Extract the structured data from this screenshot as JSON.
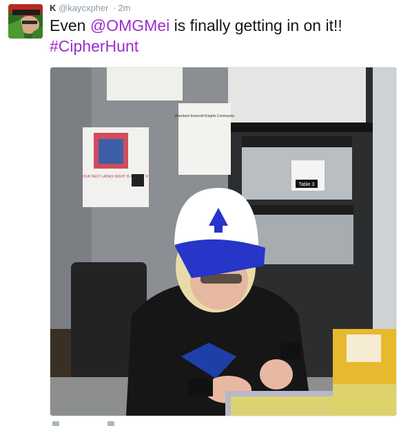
{
  "tweet": {
    "display_name": "K",
    "handle": "@kaycxpher",
    "separator": "·",
    "time": "2m",
    "text_before": "Even ",
    "mention": "@OMGMei",
    "text_after": " is finally getting in on it!!",
    "hashtag": "#CipherHunt"
  },
  "photo": {
    "poster_heading": "OUR NEXT LADIES NIGHT IS AUGUST 6!",
    "board_heading": "Aberdeen Emerald Knights Community",
    "bin_label": "Table 3"
  },
  "colors": {
    "link": "#9a2dcc",
    "text": "#14171a",
    "meta": "#8899a6"
  }
}
